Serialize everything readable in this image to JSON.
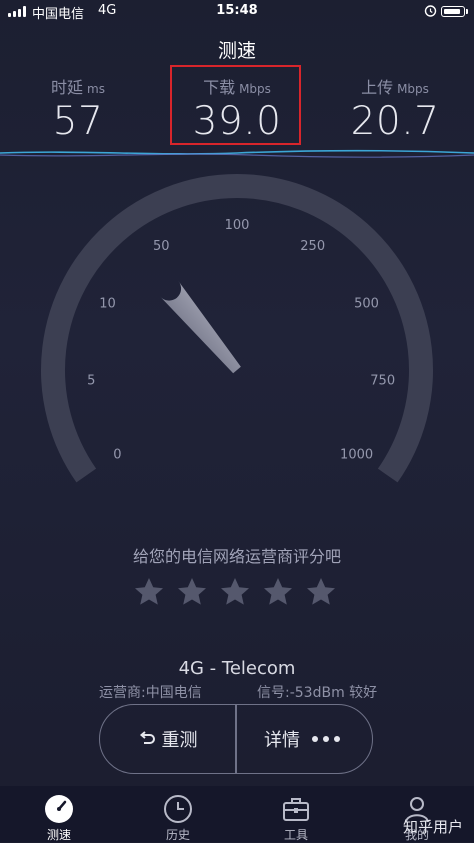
{
  "status_bar": {
    "carrier": "中国电信",
    "network": "4G",
    "time": "15:48"
  },
  "header": {
    "title": "测速"
  },
  "metrics": {
    "ping": {
      "label": "时延",
      "unit": "ms",
      "value": "57"
    },
    "download": {
      "label": "下载",
      "unit": "Mbps",
      "value": "39.0"
    },
    "upload": {
      "label": "上传",
      "unit": "Mbps",
      "value": "20.7"
    }
  },
  "gauge": {
    "scale_labels": [
      "0",
      "5",
      "10",
      "50",
      "100",
      "250",
      "500",
      "750",
      "1000"
    ],
    "needle_value": 39.0
  },
  "rating": {
    "prompt": "给您的电信网络运营商评分吧",
    "stars": 5,
    "filled": 0
  },
  "network_info": {
    "title": "4G - Telecom",
    "carrier": "运营商:中国电信",
    "signal": "信号:-53dBm 较好"
  },
  "actions": {
    "retest": "重测",
    "details": "详情"
  },
  "tabs": [
    {
      "label": "测速",
      "icon": "speedometer-icon",
      "active": true
    },
    {
      "label": "历史",
      "icon": "clock-icon",
      "active": false
    },
    {
      "label": "工具",
      "icon": "toolbox-icon",
      "active": false
    },
    {
      "label": "我的",
      "icon": "user-icon",
      "active": false
    }
  ],
  "watermark": "知乎用户",
  "colors": {
    "background": "#1c1f31",
    "highlight_box": "#d8252b",
    "wave_accent": "#3fb5e8"
  }
}
